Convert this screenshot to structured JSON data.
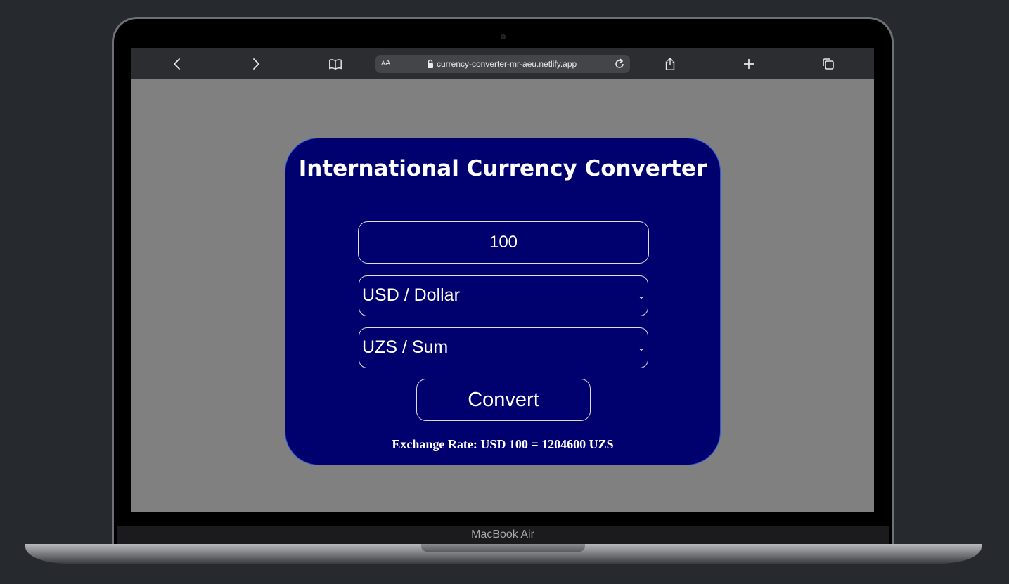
{
  "device": {
    "model_label": "MacBook Air"
  },
  "browser": {
    "text_size_label": "AA",
    "url": "currency-converter-mr-aeu.netlify.app",
    "icons": [
      "back-icon",
      "forward-icon",
      "bookmarks-icon",
      "lock-icon",
      "reload-icon",
      "share-icon",
      "new-tab-icon",
      "tabs-icon"
    ]
  },
  "app": {
    "title": "International Currency Converter",
    "amount_value": "100",
    "from_currency": "USD / Dollar",
    "to_currency": "UZS / Sum",
    "convert_label": "Convert",
    "exchange_rate_text": "Exchange Rate: USD 100 = 1204600 UZS",
    "colors": {
      "page_bg": "#808080",
      "card_bg": "#00006e",
      "card_border": "#2e5bdd",
      "text": "#ffffff"
    }
  }
}
